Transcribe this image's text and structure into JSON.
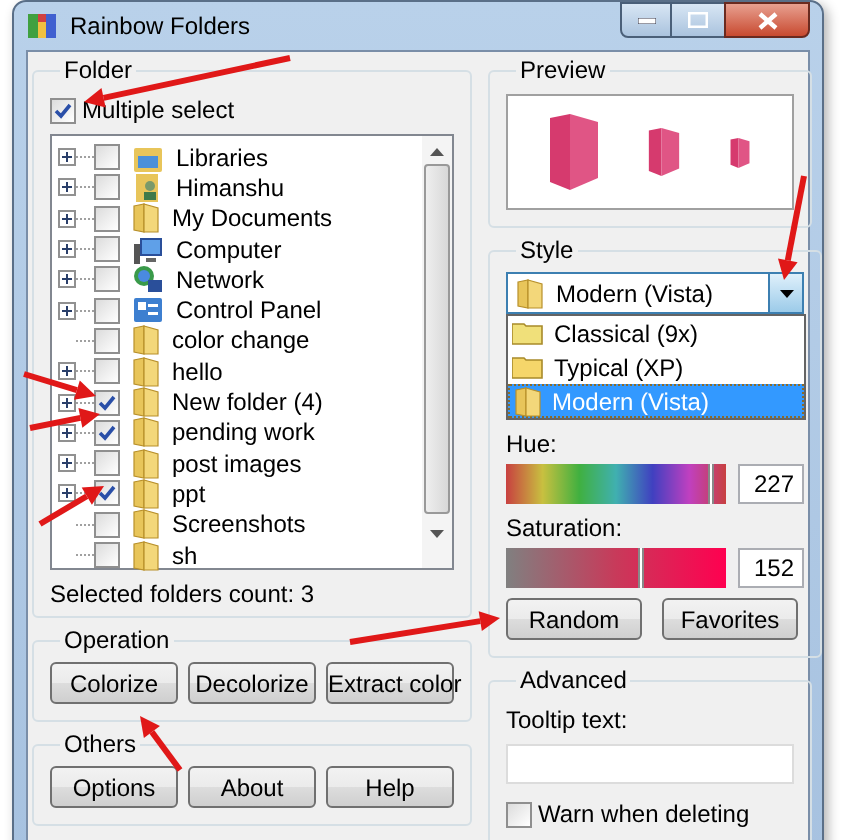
{
  "window": {
    "title": "Rainbow Folders"
  },
  "folder": {
    "label": "Folder",
    "multiple_select": {
      "label": "Multiple select",
      "checked": true
    },
    "tree": [
      {
        "name": "Libraries",
        "kind": "library",
        "expandable": true,
        "checked": false
      },
      {
        "name": "Himanshu",
        "kind": "user",
        "expandable": true,
        "checked": false
      },
      {
        "name": "My Documents",
        "kind": "documents",
        "expandable": true,
        "checked": false
      },
      {
        "name": "Computer",
        "kind": "computer",
        "expandable": true,
        "checked": false
      },
      {
        "name": "Network",
        "kind": "network",
        "expandable": true,
        "checked": false
      },
      {
        "name": "Control Panel",
        "kind": "control_panel",
        "expandable": true,
        "checked": false
      },
      {
        "name": "color change",
        "kind": "folder",
        "expandable": false,
        "checked": false
      },
      {
        "name": "hello",
        "kind": "folder",
        "expandable": true,
        "checked": false
      },
      {
        "name": "New folder (4)",
        "kind": "folder",
        "expandable": true,
        "checked": true
      },
      {
        "name": "pending work",
        "kind": "folder",
        "expandable": true,
        "checked": true
      },
      {
        "name": "post images",
        "kind": "folder",
        "expandable": true,
        "checked": false
      },
      {
        "name": "ppt",
        "kind": "folder",
        "expandable": true,
        "checked": true
      },
      {
        "name": "Screenshots",
        "kind": "folder",
        "expandable": false,
        "checked": false
      },
      {
        "name": "sh",
        "kind": "folder",
        "expandable": false,
        "checked": false
      }
    ],
    "count": "Selected folders count: 3"
  },
  "operation": {
    "label": "Operation",
    "buttons": [
      "Colorize",
      "Decolorize",
      "Extract color"
    ]
  },
  "others": {
    "label": "Others",
    "buttons": [
      "Options",
      "About",
      "Help"
    ]
  },
  "preview": {
    "label": "Preview"
  },
  "style": {
    "label": "Style",
    "value": "Modern (Vista)",
    "options": [
      {
        "label": "Classical (9x)",
        "kind": "classic",
        "selected": false
      },
      {
        "label": "Typical (XP)",
        "kind": "xp",
        "selected": false
      },
      {
        "label": "Modern (Vista)",
        "kind": "vista",
        "selected": true
      }
    ],
    "hue": {
      "label": "Hue:",
      "level": 0.94,
      "value": "227"
    },
    "saturation": {
      "label": "Saturation:",
      "level": 0.62,
      "value": "152"
    },
    "buttons": [
      "Random",
      "Favorites"
    ]
  },
  "advanced": {
    "label": "Advanced",
    "tooltip_label": "Tooltip text:",
    "warn": {
      "label": "Warn when deleting",
      "checked": false
    }
  }
}
